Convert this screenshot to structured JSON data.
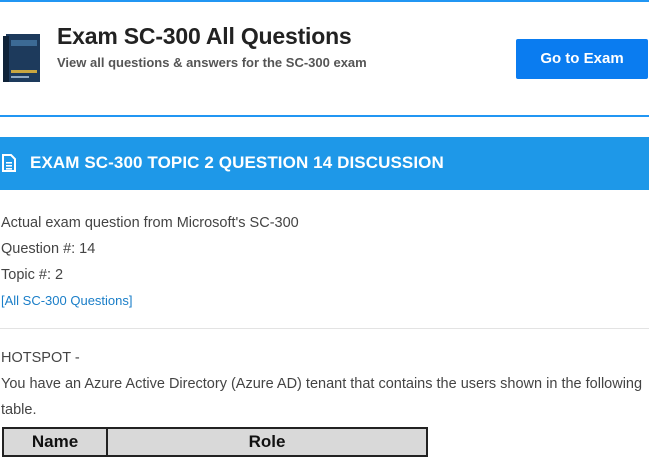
{
  "header": {
    "title": "Exam SC-300 All Questions",
    "subtitle": "View all questions & answers for the SC-300 exam",
    "go_button": "Go to Exam"
  },
  "banner": {
    "icon": "document-icon",
    "title": "EXAM SC-300 TOPIC 2 QUESTION 14 DISCUSSION"
  },
  "meta": {
    "source": "Actual exam question from Microsoft's SC-300",
    "question_number": "Question #: 14",
    "topic": "Topic #: 2",
    "all_link": "[All SC-300 Questions]"
  },
  "question": {
    "type": "HOTSPOT -",
    "body": "You have an Azure Active Directory (Azure AD) tenant that contains the users shown in the following table."
  },
  "table": {
    "headers": [
      "Name",
      "Role"
    ]
  },
  "colors": {
    "accent": "#1e98e8",
    "button": "#0a7cf0",
    "link": "#1a7ec8"
  }
}
